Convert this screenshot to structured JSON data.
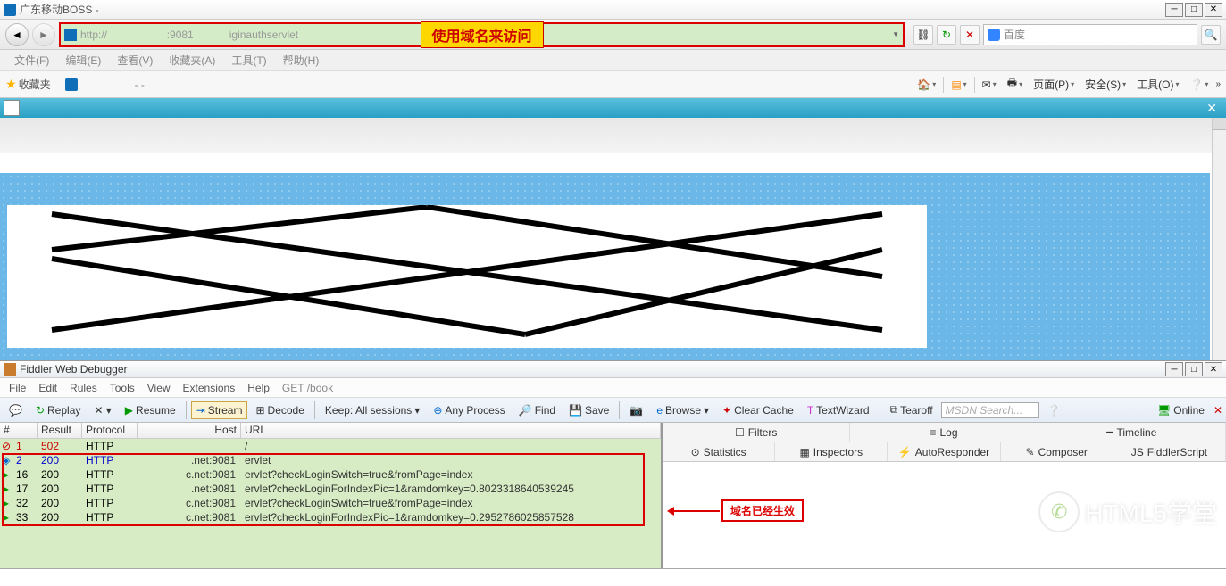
{
  "ie": {
    "title": "广东移动BOSS -",
    "url": "http://                    :9081            iginauthservlet",
    "annotation": "使用域名来访问",
    "searchPlaceholder": "百度",
    "menus": [
      "文件(F)",
      "编辑(E)",
      "查看(V)",
      "收藏夹(A)",
      "工具(T)",
      "帮助(H)"
    ],
    "favLabel": "收藏夹",
    "toolbarRight": {
      "page": "页面(P)",
      "safety": "安全(S)",
      "tools": "工具(O)"
    }
  },
  "fiddler": {
    "title": "Fiddler Web Debugger",
    "menus": [
      "File",
      "Edit",
      "Rules",
      "Tools",
      "View",
      "Extensions",
      "Help",
      "GET /book"
    ],
    "toolbar": {
      "replay": "Replay",
      "resume": "Resume",
      "stream": "Stream",
      "decode": "Decode",
      "keep": "Keep: All sessions",
      "anyProcess": "Any Process",
      "find": "Find",
      "save": "Save",
      "browse": "Browse",
      "clearCache": "Clear Cache",
      "textWizard": "TextWizard",
      "tearoff": "Tearoff",
      "msdn": "MSDN Search...",
      "online": "Online"
    },
    "columns": {
      "num": "#",
      "result": "Result",
      "protocol": "Protocol",
      "host": "Host",
      "url": "URL"
    },
    "rows": [
      {
        "num": "1",
        "result": "502",
        "protocol": "HTTP",
        "host": "",
        "url": "/",
        "type": "error"
      },
      {
        "num": "2",
        "result": "200",
        "protocol": "HTTP",
        "host": ".net:9081",
        "url": "ervlet",
        "type": "blue"
      },
      {
        "num": "16",
        "result": "200",
        "protocol": "HTTP",
        "host": "c.net:9081",
        "url": "ervlet?checkLoginSwitch=true&fromPage=index",
        "type": "ok"
      },
      {
        "num": "17",
        "result": "200",
        "protocol": "HTTP",
        "host": ".net:9081",
        "url": "ervlet?checkLoginForIndexPic=1&ramdomkey=0.8023318640539245",
        "type": "ok"
      },
      {
        "num": "32",
        "result": "200",
        "protocol": "HTTP",
        "host": "c.net:9081",
        "url": "ervlet?checkLoginSwitch=true&fromPage=index",
        "type": "ok"
      },
      {
        "num": "33",
        "result": "200",
        "protocol": "HTTP",
        "host": "c.net:9081",
        "url": "ervlet?checkLoginForIndexPic=1&ramdomkey=0.2952786025857528",
        "type": "ok"
      }
    ],
    "annotation2": "域名已经生效",
    "rightTabs1": [
      {
        "icon": "☐",
        "label": "Filters"
      },
      {
        "icon": "≡",
        "label": "Log"
      },
      {
        "icon": "━",
        "label": "Timeline"
      }
    ],
    "rightTabs2": [
      {
        "icon": "⊙",
        "label": "Statistics"
      },
      {
        "icon": "▦",
        "label": "Inspectors"
      },
      {
        "icon": "⚡",
        "label": "AutoResponder"
      },
      {
        "icon": "✎",
        "label": "Composer"
      },
      {
        "icon": "JS",
        "label": "FiddlerScript"
      }
    ]
  },
  "watermark": "HTML5学堂"
}
